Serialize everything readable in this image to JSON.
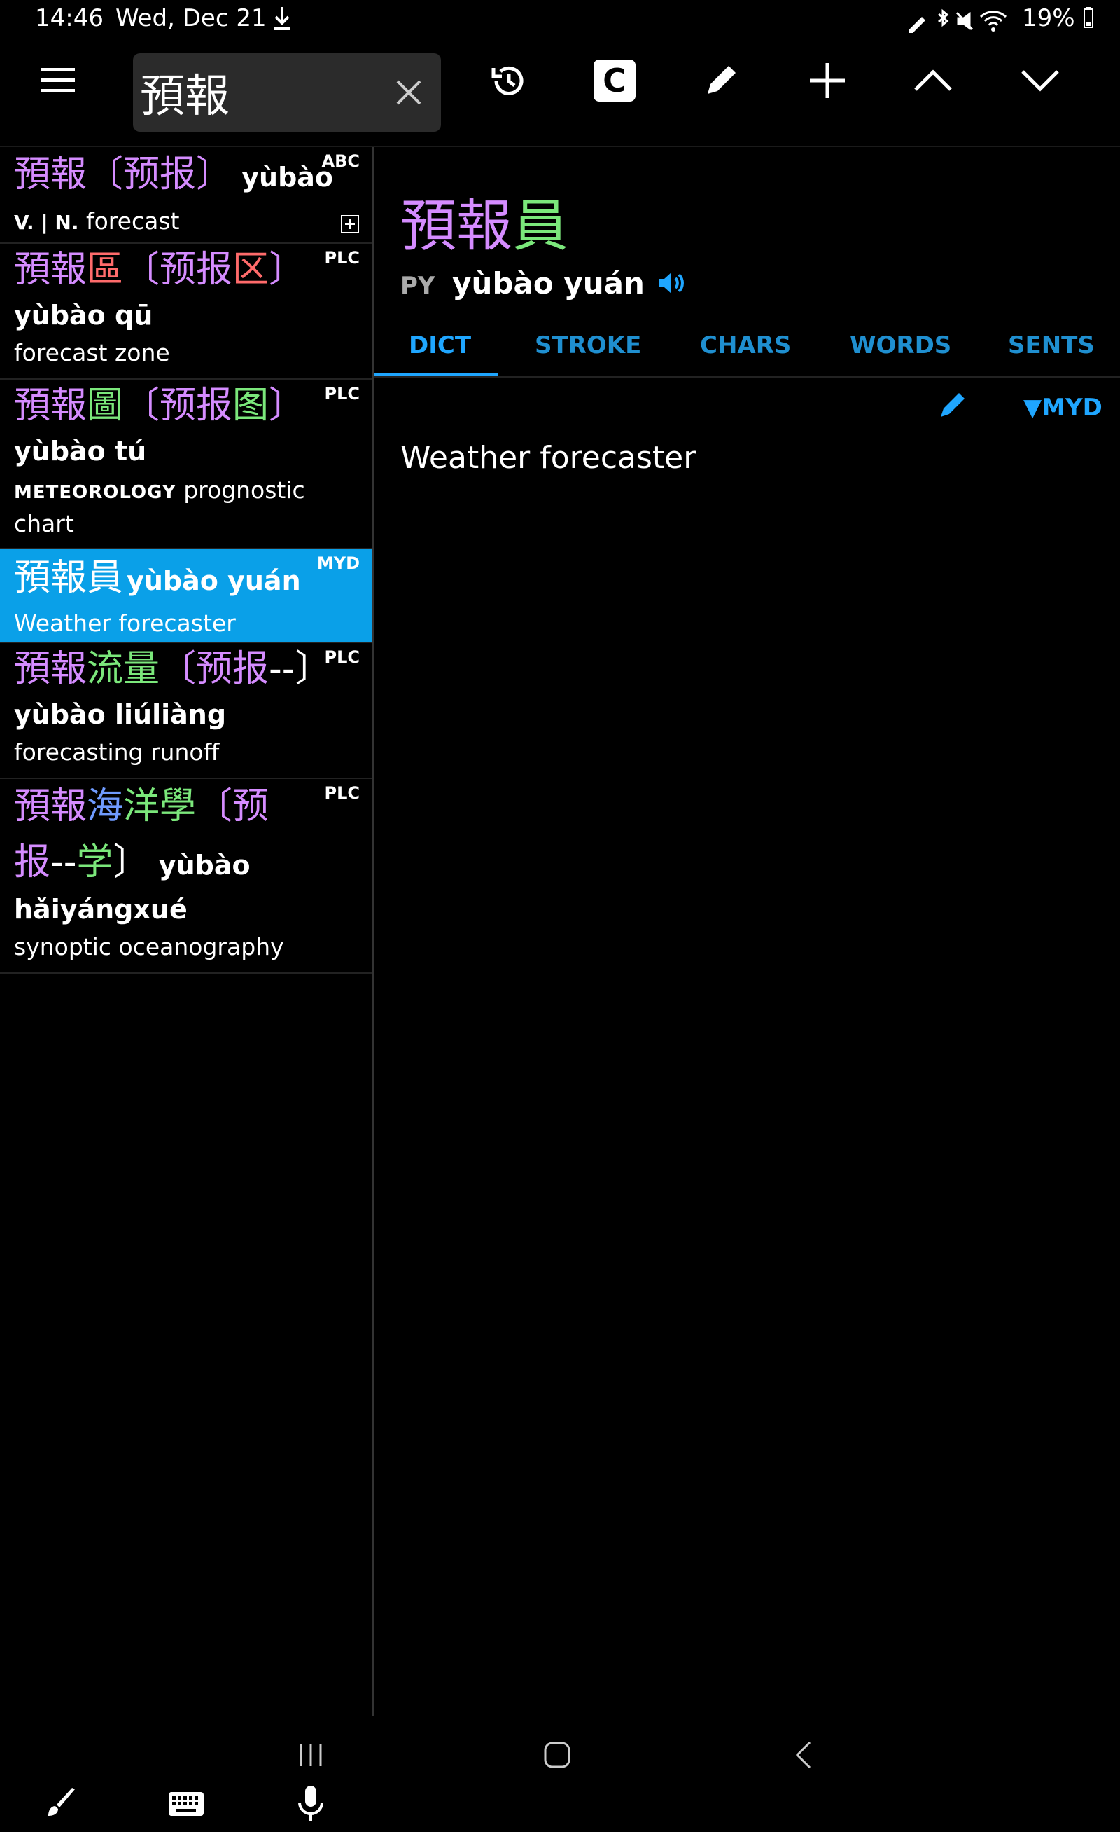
{
  "status_bar": {
    "time": "14:46",
    "date": "Wed, Dec 21",
    "battery": "19%"
  },
  "search": {
    "query": "預報"
  },
  "toolbar": {
    "c_button_label": "C"
  },
  "entries": [
    {
      "source": "ABC",
      "line1": [
        {
          "text": "預報",
          "c": "pur"
        },
        {
          "text": "〔预报〕",
          "c": "pur"
        },
        {
          "text": " yùbào",
          "c": "py"
        }
      ],
      "pos": "V. | N.",
      "definition": "forecast"
    },
    {
      "source": "PLC",
      "line1": [
        {
          "text": "預報",
          "c": "pur"
        },
        {
          "text": "區",
          "c": "red"
        },
        {
          "text": "〔预报",
          "c": "pur"
        },
        {
          "text": "区",
          "c": "red"
        },
        {
          "text": "〕",
          "c": "pur"
        }
      ],
      "pinyin": "yùbào qū",
      "definition": "forecast zone"
    },
    {
      "source": "PLC",
      "line1": [
        {
          "text": "預報",
          "c": "pur"
        },
        {
          "text": "圖",
          "c": "grn"
        },
        {
          "text": "〔预报",
          "c": "pur"
        },
        {
          "text": "图",
          "c": "grn"
        },
        {
          "text": "〕",
          "c": "pur"
        }
      ],
      "pinyin": "yùbào tú",
      "domain": "METEOROLOGY",
      "definition_a": "prognostic",
      "definition_b": "chart"
    },
    {
      "source": "MYD",
      "headword": "預報員",
      "pinyin": "yùbào yuán",
      "definition": "Weather forecaster"
    },
    {
      "source": "PLC",
      "line1": [
        {
          "text": "預報",
          "c": "pur"
        },
        {
          "text": "流量",
          "c": "grn"
        },
        {
          "text": "〔预报",
          "c": "pur"
        },
        {
          "text": "--〕",
          "c": "wht"
        }
      ],
      "pinyin": "yùbào liúliàng",
      "definition": "forecasting runoff"
    },
    {
      "source": "PLC",
      "line1": [
        {
          "text": "預報",
          "c": "pur"
        },
        {
          "text": "海",
          "c": "blu"
        },
        {
          "text": "洋學",
          "c": "grn"
        },
        {
          "text": "〔预",
          "c": "pur"
        }
      ],
      "line2": [
        {
          "text": "报",
          "c": "pur"
        },
        {
          "text": "--",
          "c": "wht"
        },
        {
          "text": "学",
          "c": "grn"
        },
        {
          "text": "〕",
          "c": "wht"
        },
        {
          "text": " yùbào",
          "c": "py"
        }
      ],
      "pinyin": "hǎiyángxué",
      "definition": "synoptic oceanography"
    }
  ],
  "detail": {
    "headword_part1": "預報",
    "headword_part2": "員",
    "pinyin_label": "PY",
    "pinyin": "yùbào yuán",
    "tabs": [
      "DICT",
      "STROKE",
      "CHARS",
      "WORDS",
      "SENTS"
    ],
    "source_dropdown": "▼MYD",
    "definition": "Weather forecaster"
  },
  "colors": {
    "accent": "#1fa6ff",
    "selected_row": "#0aa0e8",
    "purple": "#d58cff",
    "green": "#7be77b",
    "red": "#ff6b6b",
    "blue": "#6f9bff"
  }
}
